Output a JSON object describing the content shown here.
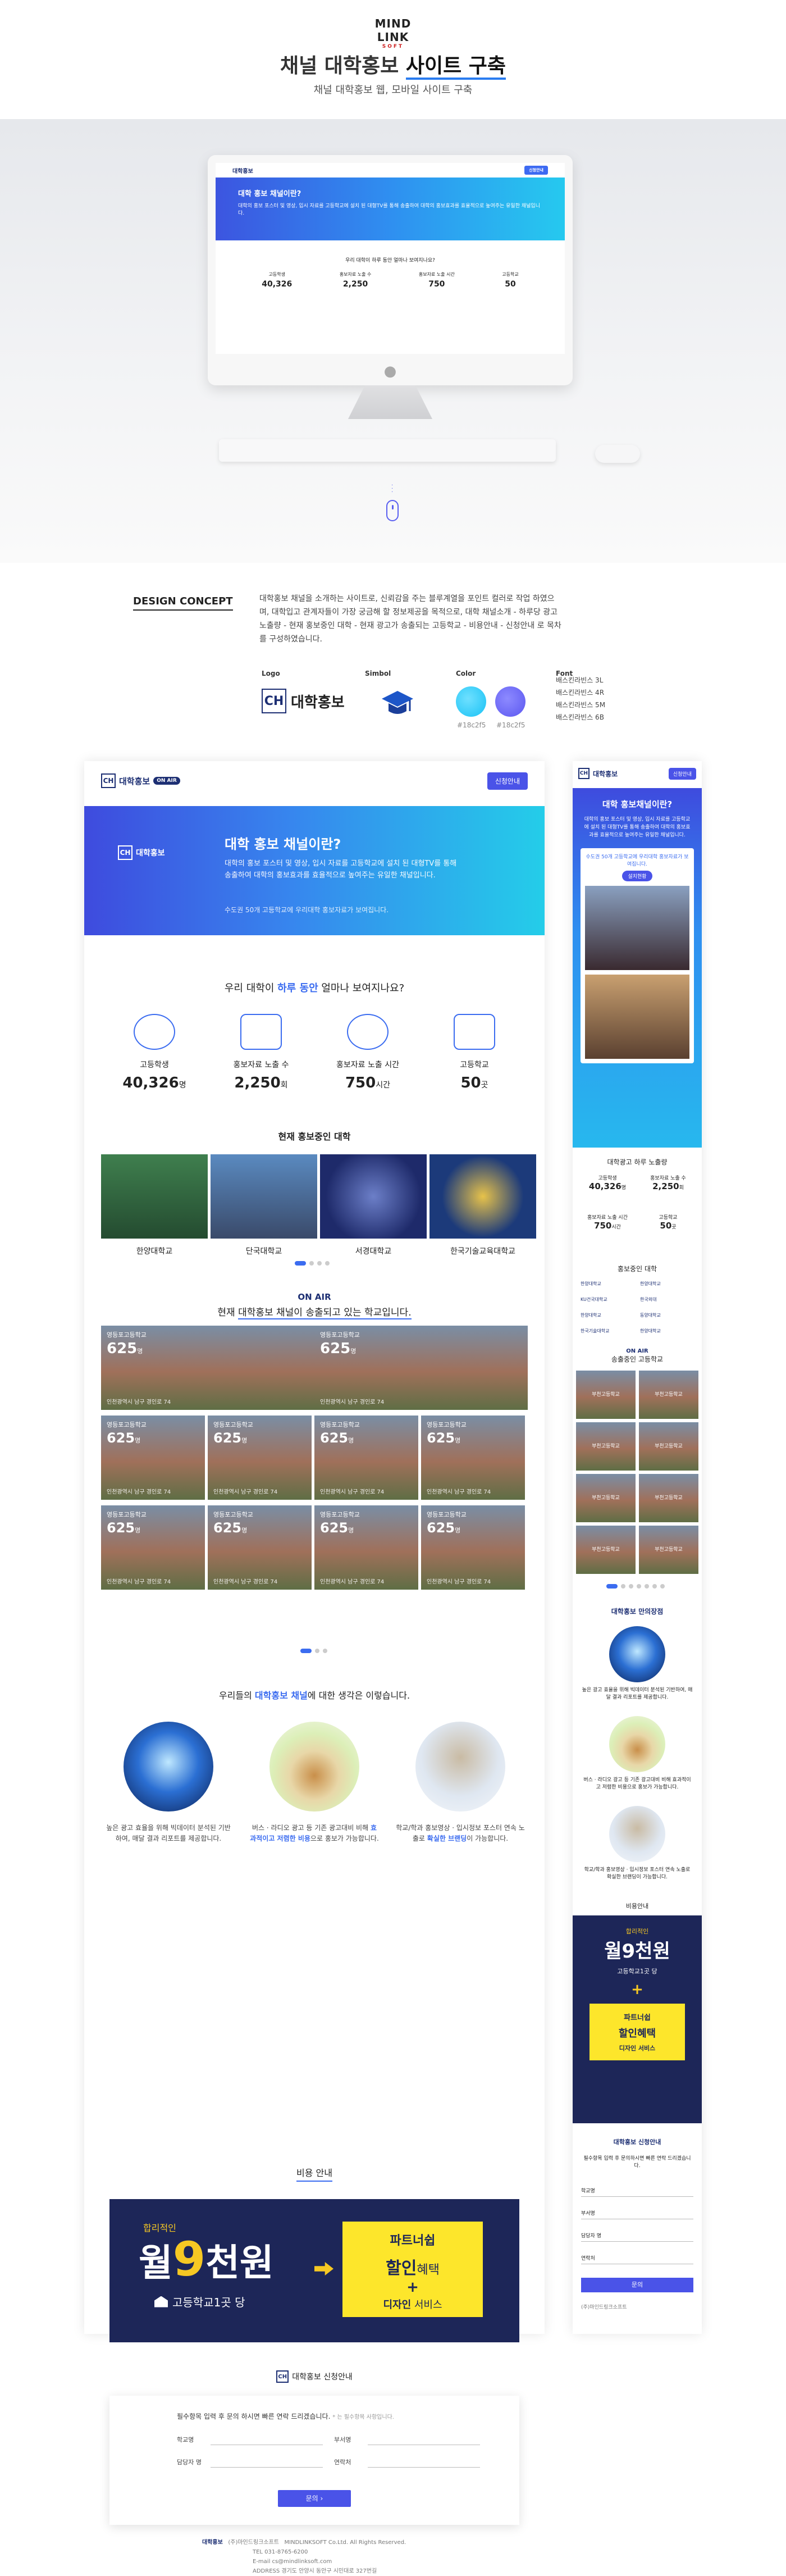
{
  "header": {
    "logo": "MIND LINK",
    "logo_sub": "SOFT",
    "title_pre": "채널 대학홍보 ",
    "title_hl": "사이트 구축",
    "subtitle": "채널 대학홍보 웹, 모바일 사이트 구축"
  },
  "concept": {
    "label": "DESIGN CONCEPT",
    "text": "대학홍보 채널을 소개하는 사이트로, 신뢰감을 주는 블루계열을 포인트 컬러로 작업 하였으며, 대학입고 관계자들이 가장 궁금해 할 정보제공을 목적으로, 대학 채널소개 - 하루당 광고노출량 - 현재 홍보중인 대학 - 현재 광고가 송출되는 고등학교 - 비용안내 - 신청안내 로 목차를 구성하였습니다.",
    "logo_label": "Logo",
    "symbol_label": "Simbol",
    "color_label": "Color",
    "font_label": "Font",
    "logo_text": "대학홍보",
    "colors": [
      {
        "hex": "#18c2f5",
        "label": "#18c2f5"
      },
      {
        "hex": "#5b57f0",
        "label": "#18c2f5"
      }
    ],
    "fonts": [
      "배스킨라빈스 3L",
      "배스킨라빈스 4R",
      "배스킨라빈스 5M",
      "배스킨라빈스 6B"
    ]
  },
  "mockup": {
    "site_title": "대학 홍보 채널이란?",
    "question": "우리 대학이 하루 동안 얼마나 보여지나요?",
    "stats": [
      {
        "label": "고등학생",
        "value": "40,326",
        "unit": "명"
      },
      {
        "label": "홍보자료 노출 수",
        "value": "2,250",
        "unit": "회"
      },
      {
        "label": "홍보자료 노출 시간",
        "value": "750",
        "unit": "시간"
      },
      {
        "label": "고등학교",
        "value": "50",
        "unit": "곳"
      }
    ]
  },
  "desktop": {
    "logo": "대학홍보",
    "onair": "ON AIR",
    "apply_btn": "신청안내",
    "banner_logo": "대학홍보",
    "banner_title": "대학 홍보 채널이란?",
    "banner_text": "대학의 홍보 포스터 및 영상, 입시 자료를 고등학교에 설치 된 대형TV를 통해 송출하여 대학의 홍보효과를 효율적으로 높여주는 유일한 채널입니다.",
    "banner_note": "수도권 50개 고등학교에 우리대학 홍보자료가 보여집니다.",
    "q_pre": "우리 대학이 ",
    "q_hl": "하루 동안",
    "q_post": " 얼마나 보여지나요?",
    "univ_title": "현재 홍보중인 대학",
    "univs": [
      "한양대학교",
      "단국대학교",
      "서경대학교",
      "한국기술교육대학교"
    ],
    "onair_label": "ON AIR",
    "onair_pre": "현재 ",
    "onair_hl": "대학홍보 채널이 송출되고 있는 학교입니다.",
    "school_name": "영등포고등학교",
    "school_count": "625",
    "school_unit": "명",
    "school_addr": "인천광역시 남구 경인로 74",
    "opinion_pre": "우리들의 ",
    "opinion_hl": "대학홍보 채널",
    "opinion_post": "에 대한 생각은 이렇습니다.",
    "opinions": [
      {
        "pre": "높은 광고 효율을 위해 빅데이터 분석된 기반하여, ",
        "hl": "",
        "post": "매달 결과 리포트를 제공합니다."
      },
      {
        "pre": "버스 · 라디오 광고 등 기존 광고대비 비해 ",
        "hl": "효과적이고 저렴한 비용",
        "post": "으로 홍보가 가능합니다."
      },
      {
        "pre": "학교/학과 홍보영상 · 입시정보 포스터 연속 노출로 ",
        "hl": "확실한 브랜딩",
        "post": "이 가능합니다."
      }
    ],
    "cost_title": "비용 안내",
    "cost_l1": "합리적인",
    "cost_month": "월",
    "cost_num": "9",
    "cost_unit": "천원",
    "cost_per": "고등학교1곳 당",
    "partner": "파트너쉽",
    "discount": "할인",
    "discount_post": "혜택",
    "plus": "+",
    "design": "디자인",
    "design_post": " 서비스",
    "apply_title": "대학홍보 신청안내",
    "form_note": "필수항목 입력 후 문의 하시면 빠른 연락 드리겠습니다.",
    "form_note_small": "* 는 필수항목 사항입니다.",
    "fields": [
      "학교명",
      "부서명",
      "담당자 명",
      "연락처"
    ],
    "submit": "문의",
    "footer_co": "(주)마인드링크소프트",
    "footer_copy": "MINDLINKSOFT Co.Ltd. All Rights Reserved.",
    "footer_tel": "TEL 031-8765-6200",
    "footer_email": "E-mail cs@mindlinksoft.com",
    "footer_addr": "ADDRESS 경기도 안양시 동안구 시민대로 327번길"
  },
  "mobile": {
    "logo": "대학홍보",
    "apply_btn": "신청안내",
    "banner_title": "대학 홍보채널이란?",
    "banner_text": "대학의 홍보 포스터 및 영상, 입시 자료를 고등학교에 설치 된 대형TV를 통해 송출하여 대학의 홍보효과를 효율적으로 높여주는 유일한 채널입니다.",
    "banner_note": "수도권 50개 고등학교에 우리대학 홍보자료가 보여집니다.",
    "banner_btn": "설치현황",
    "ad_title": "대학광고 하루 노출량",
    "stats": [
      {
        "label": "고등학생",
        "value": "40,326",
        "unit": "명"
      },
      {
        "label": "홍보자료 노출 수",
        "value": "2,250",
        "unit": "회"
      },
      {
        "label": "홍보자료 노출 시간",
        "value": "750",
        "unit": "시간"
      },
      {
        "label": "고등학교",
        "value": "50",
        "unit": "곳"
      }
    ],
    "univ_title": "홍보중인 대학",
    "univs": [
      "한양대학교",
      "한양대학교",
      "KU건국대학교",
      "한국외대",
      "한양대학교",
      "동양대학교",
      "한국기술대학교",
      "한양대학교"
    ],
    "onair_label": "ON AIR",
    "onair_title": "송출중인 고등학교",
    "schools": [
      "부천고등학교",
      "부천고등학교",
      "부천고등학교",
      "부천고등학교",
      "부천고등학교",
      "부천고등학교",
      "부천고등학교",
      "부천고등학교"
    ],
    "strong_title": "대학홍보 만의장점",
    "strong": [
      "높은 광고 효율을 위해 빅데이터 분석된 기반하여, 매달 결과 리포트를 제공합니다.",
      "버스 · 라디오 광고 등 기존 광고대비 비해 효과적이고 저렴한 비용으로 홍보가 가능합니다.",
      "학교/학과 홍보영상 · 입시정보 포스터 연속 노출로 확실한 브랜딩이 가능합니다."
    ],
    "cost_title": "비용안내",
    "cost_l1": "합리적인",
    "cost_big": "월9천원",
    "cost_per": "고등학교1곳 당",
    "partner": "파트너쉽",
    "discount": "할인혜택",
    "design": "디자인 서비스",
    "apply_title": "대학홍보 신청안내",
    "form_note": "필수항목 입력 후 문의하시면 빠른 연락 드리겠습니다.",
    "fields": [
      "학교명",
      "부서명",
      "담당자 명",
      "연락처"
    ],
    "submit": "문의",
    "footer_co": "(주)마인드링크소프트"
  }
}
